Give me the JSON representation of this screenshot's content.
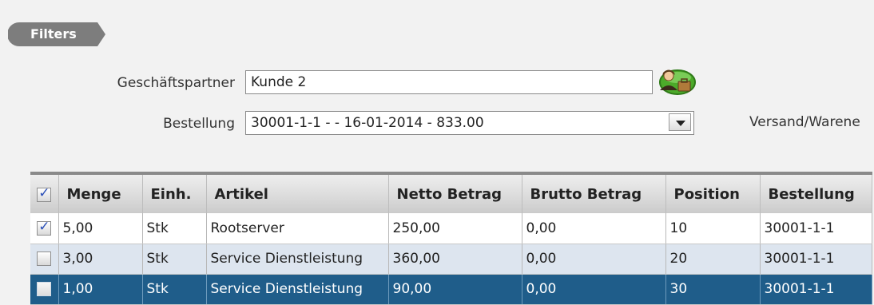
{
  "filters": {
    "label": "Filters"
  },
  "form": {
    "partner_label": "Geschäftspartner",
    "partner_value": "Kunde 2",
    "order_label": "Bestellung",
    "order_value": "30001-1-1 - - 16-01-2014 - 833.00",
    "shipping_label": "Versand/Warene"
  },
  "table": {
    "header_checked": true,
    "headers": [
      "Menge",
      "Einh.",
      "Artikel",
      "Netto Betrag",
      "Brutto Betrag",
      "Position",
      "Bestellung"
    ],
    "rows": [
      {
        "checked": true,
        "menge": "5,00",
        "einh": "Stk",
        "artikel": "Rootserver",
        "netto": "250,00",
        "brutto": "0,00",
        "position": "10",
        "bestellung": "30001-1-1"
      },
      {
        "checked": false,
        "menge": "3,00",
        "einh": "Stk",
        "artikel": "Service Dienstleistung",
        "netto": "360,00",
        "brutto": "0,00",
        "position": "20",
        "bestellung": "30001-1-1"
      },
      {
        "checked": false,
        "menge": "1,00",
        "einh": "Stk",
        "artikel": "Service Dienstleistung",
        "netto": "90,00",
        "brutto": "0,00",
        "position": "30",
        "bestellung": "30001-1-1",
        "selected": true
      }
    ]
  }
}
